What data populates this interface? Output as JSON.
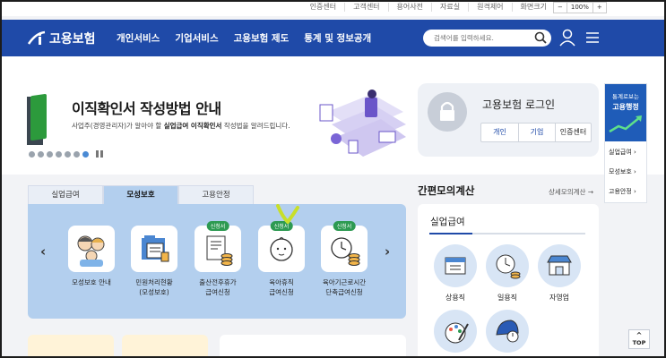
{
  "util": {
    "links": [
      "인증센터",
      "고객센터",
      "용어사전",
      "자료실",
      "원격제어",
      "화면크기"
    ],
    "zoom_minus": "−",
    "zoom_level": "100%",
    "zoom_plus": "+"
  },
  "nav": {
    "logo_text": "고용보험",
    "menu": [
      "개인서비스",
      "기업서비스",
      "고용보험 제도",
      "통계 및 정보공개"
    ],
    "search_placeholder": "검색어를 입력하세요."
  },
  "slide": {
    "title": "이직확인서 작성방법 안내",
    "desc_prefix": "사업주(경영관리자)가 알아야 할 ",
    "desc_bold": "실업급여 이직확인서",
    "desc_suffix": " 작성법을 알려드립니다.",
    "dot_count": 8,
    "active_dot": 7
  },
  "login": {
    "title": "고용보험 로그인",
    "buttons": [
      "개인",
      "기업",
      "인증센터"
    ]
  },
  "rpanel": {
    "line1": "통계로보는",
    "line2": "고용행정",
    "items": [
      "실업급여 ›",
      "모성보호 ›",
      "고용안정 ›"
    ]
  },
  "tabs": [
    "실업급여",
    "모성보호",
    "고용안정"
  ],
  "active_tab": 1,
  "services": [
    {
      "label1": "모성보호 안내",
      "label2": "",
      "badge": ""
    },
    {
      "label1": "민원처리현황",
      "label2": "(모성보호)",
      "badge": ""
    },
    {
      "label1": "출산전후휴가",
      "label2": "급여신청",
      "badge": "신청서"
    },
    {
      "label1": "육아휴직",
      "label2": "급여신청",
      "badge": "신청서"
    },
    {
      "label1": "육아기근로시간",
      "label2": "단축급여신청",
      "badge": "신청서"
    }
  ],
  "calc": {
    "title": "간편모의계산",
    "more": "상세모의계산 →",
    "sub": "실업급여",
    "items": [
      "상용직",
      "일용직",
      "자영업"
    ]
  },
  "top_btn": "TOP",
  "colors": {
    "nav_blue": "#1f4aa8",
    "tab_active": "#b3cfee",
    "badge_green": "#2d9a52"
  }
}
